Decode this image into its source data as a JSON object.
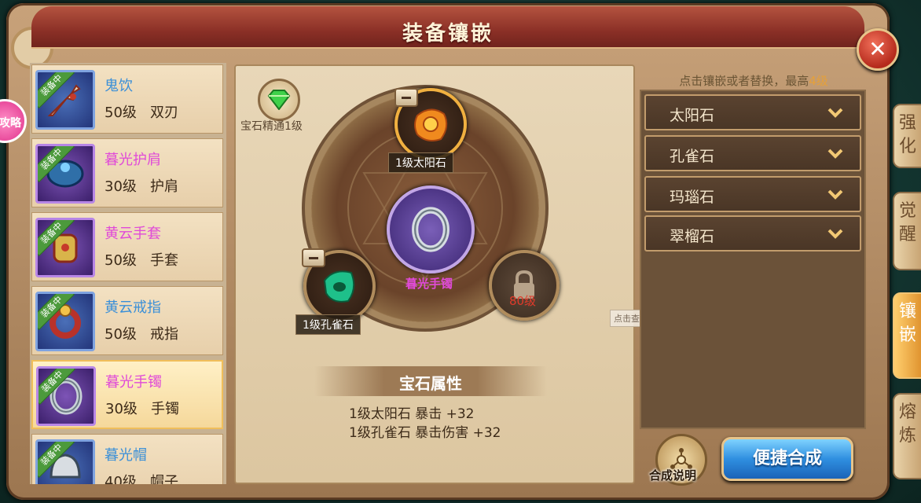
{
  "window": {
    "title": "装备镶嵌"
  },
  "equipment_list": [
    {
      "tag": "装备中",
      "name": "鬼饮",
      "level": "50级",
      "type": "双刃",
      "name_color": "#3a8fd8",
      "icon": "dagger-icon",
      "selected": false
    },
    {
      "tag": "装备中",
      "name": "暮光护肩",
      "level": "30级",
      "type": "护肩",
      "name_color": "#e04ad8",
      "icon": "shoulder-armor-icon",
      "selected": false
    },
    {
      "tag": "装备中",
      "name": "黄云手套",
      "level": "50级",
      "type": "手套",
      "name_color": "#e04ad8",
      "icon": "gauntlet-icon",
      "selected": false
    },
    {
      "tag": "装备中",
      "name": "黄云戒指",
      "level": "50级",
      "type": "戒指",
      "name_color": "#3a8fd8",
      "icon": "ring-icon",
      "selected": false
    },
    {
      "tag": "装备中",
      "name": "暮光手镯",
      "level": "30级",
      "type": "手镯",
      "name_color": "#e04ad8",
      "icon": "bracelet-icon",
      "selected": true
    },
    {
      "tag": "装备中",
      "name": "暮光帽",
      "level": "40级",
      "type": "帽子",
      "name_color": "#3a8fd8",
      "icon": "helmet-icon",
      "selected": false
    }
  ],
  "center": {
    "mastery_label": "宝石精通1级",
    "mastery_icon": "green-gem-icon",
    "equipped_item_name": "暮光手镯",
    "slots": {
      "top": {
        "label": "1级太阳石",
        "icon": "sun-stone-icon"
      },
      "left": {
        "label": "1级孔雀石",
        "icon": "peacock-stone-icon"
      },
      "right": {
        "label": "80级",
        "icon": "lock-icon"
      }
    },
    "attr_title": "宝石属性",
    "attrs": [
      "1级太阳石 暴击 +32",
      "1级孔雀石 暴击伤害 +32"
    ],
    "tooltip_text": "点击查看源网页"
  },
  "right": {
    "hint_prefix": "点击镶嵌或者替换，最高",
    "hint_highlight": "4级",
    "gems": [
      "太阳石",
      "孔雀石",
      "玛瑙石",
      "翠榴石"
    ],
    "help_label": "合成说明",
    "compose_label": "便捷合成"
  },
  "side_tabs": [
    {
      "label": [
        "强",
        "化"
      ],
      "active": false
    },
    {
      "label": [
        "觉",
        "醒"
      ],
      "active": false
    },
    {
      "label": [
        "镶",
        "嵌"
      ],
      "active": true
    },
    {
      "label": [
        "熔",
        "炼"
      ],
      "active": false
    }
  ],
  "strategy_label": "攻略",
  "colors": {
    "accent_gold": "#e5a03a",
    "active_tab": "#e09430",
    "blue_name": "#3a8fd8",
    "pink_name": "#e04ad8"
  }
}
